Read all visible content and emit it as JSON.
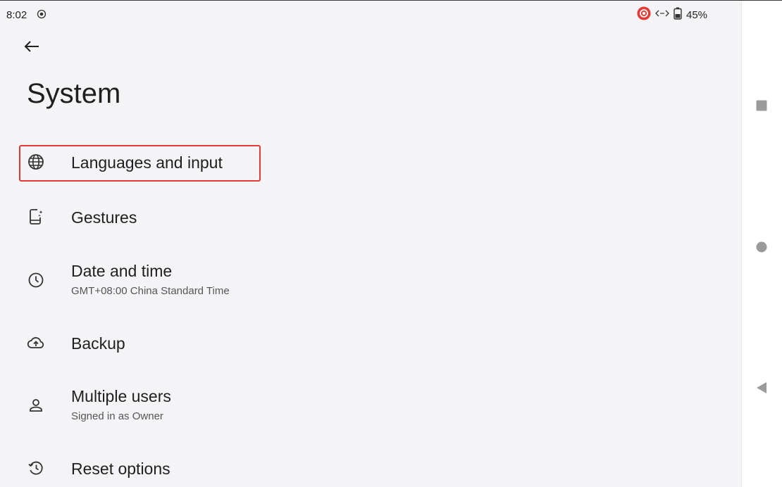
{
  "status_bar": {
    "time": "8:02",
    "battery_pct": "45%",
    "rec_color": "#e53935"
  },
  "page": {
    "title": "System"
  },
  "items": [
    {
      "label": "Languages and input",
      "icon": "globe-icon"
    },
    {
      "label": "Gestures",
      "icon": "phone-gesture-icon"
    },
    {
      "label": "Date and time",
      "sub": "GMT+08:00 China Standard Time",
      "icon": "clock-icon"
    },
    {
      "label": "Backup",
      "icon": "cloud-upload-icon"
    },
    {
      "label": "Multiple users",
      "sub": "Signed in as Owner",
      "icon": "person-icon"
    },
    {
      "label": "Reset options",
      "icon": "history-icon"
    }
  ],
  "highlight_color": "#e53935",
  "navbar": {
    "buttons": [
      "recents-button",
      "home-button",
      "back-button"
    ]
  }
}
